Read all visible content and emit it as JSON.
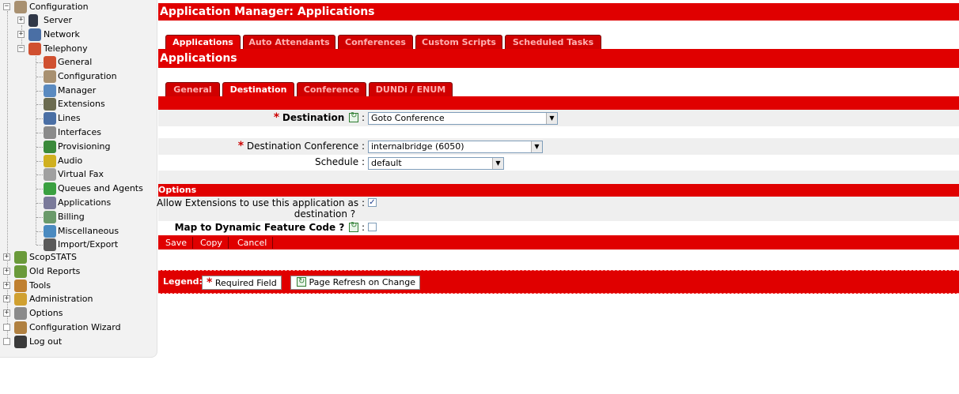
{
  "sidebar": {
    "root": "Configuration",
    "server": "Server",
    "network": "Network",
    "telephony": "Telephony",
    "telephony_items": [
      "General",
      "Configuration",
      "Manager",
      "Extensions",
      "Lines",
      "Interfaces",
      "Provisioning",
      "Audio",
      "Virtual Fax",
      "Queues and Agents",
      "Applications",
      "Billing",
      "Miscellaneous",
      "Import/Export"
    ],
    "bottom_items": [
      "ScopSTATS",
      "Old Reports",
      "Tools",
      "Administration",
      "Options",
      "Configuration Wizard",
      "Log out"
    ],
    "toggles": {
      "collapse": "−",
      "expand": "+",
      "leaf": ""
    }
  },
  "header": {
    "title": "Application Manager:  Applications"
  },
  "top_tabs": [
    "Applications",
    "Auto Attendants",
    "Conferences",
    "Custom Scripts",
    "Scheduled Tasks"
  ],
  "section_title": "Applications",
  "sub_tabs": [
    "General",
    "Destination",
    "Conference",
    "DUNDi / ENUM"
  ],
  "form": {
    "destination_label": "Destination",
    "destination_value": "Goto Conference",
    "dest_conf_label": "Destination Conference",
    "dest_conf_value": "internalbridge (6050)",
    "schedule_label": "Schedule",
    "schedule_value": "default",
    "colon": ":",
    "required_mark": "*"
  },
  "options": {
    "title": "Options",
    "allow_ext_label_1": "Allow Extensions to use this application as",
    "allow_ext_label_2": "destination ?",
    "allow_ext_checked": true,
    "map_label": "Map to Dynamic Feature Code ?",
    "map_checked": false
  },
  "buttons": {
    "save": "Save",
    "copy": "Copy",
    "cancel": "Cancel"
  },
  "legend": {
    "label": "Legend:",
    "required": "Required Field",
    "refresh": "Page Refresh on Change"
  },
  "colors": {
    "accent": "#e00000",
    "sidebar_bg": "#f2f2f2",
    "form_bg": "#efefef"
  },
  "icons": {
    "check": "✓",
    "arrow": "▼",
    "telephony_items": [
      "general-icon",
      "configuration-icon",
      "manager-icon",
      "extensions-icon",
      "lines-icon",
      "interfaces-icon",
      "provisioning-icon",
      "audio-icon",
      "virtual-fax-icon",
      "queues-icon",
      "applications-icon",
      "billing-icon",
      "miscellaneous-icon",
      "import-export-icon"
    ]
  }
}
